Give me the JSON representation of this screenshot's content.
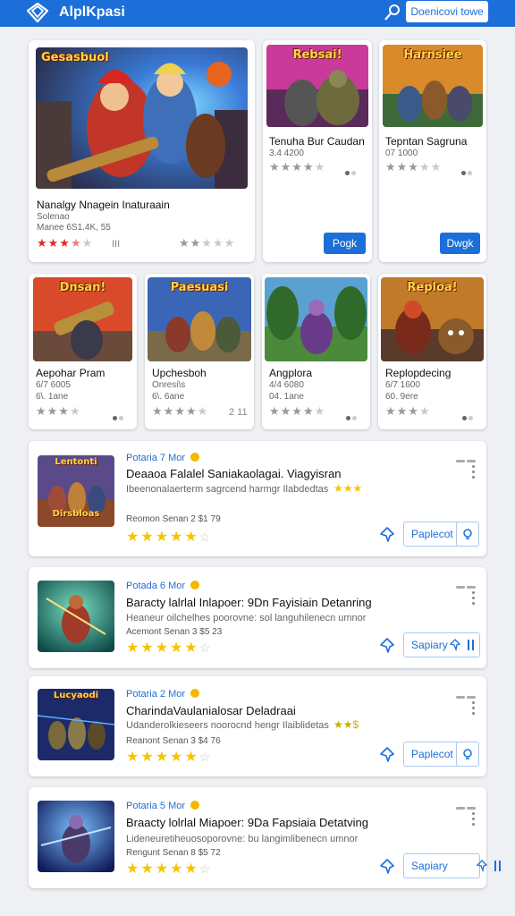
{
  "header": {
    "app_name": "AlplKpasi",
    "action_label": "Doenicovi towe",
    "colors": {
      "bar": "#1c6fd8"
    },
    "icons": [
      "app-logo-icon",
      "search-icon"
    ]
  },
  "featured": {
    "hero": {
      "banner": "Gesasbuol",
      "title": "Nanalgy Nnagein Inaturaain",
      "subtitle": "Solenao",
      "meta": "Manee 6S1.4K, 55",
      "rating": 3.5,
      "side_value": "III",
      "side_rating": 2
    },
    "cards": [
      {
        "banner": "Rebsai!",
        "title": "Tenuha Bur Caudan",
        "meta": "3.4 4200",
        "rating": 4,
        "button": "Pogk"
      },
      {
        "banner": "Harnsiee",
        "title": "Tepntan Sagruna",
        "meta": "07 1000",
        "rating": 3,
        "button": "Dwgk"
      }
    ]
  },
  "grid": [
    {
      "banner": "Dnsan!",
      "title": "Aepohar Pram",
      "line1": "6/7 6005",
      "line2": "6\\. 1ane",
      "rating": 3,
      "extra": ""
    },
    {
      "banner": "Paesuasi",
      "title": "Upchesboh",
      "line1": "Onresi\\s",
      "line2": "6\\. 6ane",
      "rating": 4,
      "extra": "2 11"
    },
    {
      "banner": "",
      "title": "Angplora",
      "line1": "4/4 6080",
      "line2": "04. 1ane",
      "rating": 4,
      "extra": ""
    },
    {
      "banner": "Reploa!",
      "title": "Replopdecing",
      "line1": "6/7 1600",
      "line2": "60. 9ere",
      "rating": 3,
      "extra": ""
    }
  ],
  "list": [
    {
      "banner": "Lentonti",
      "banner_bottom": "Dirsbloas",
      "meta": "Potaria 7 Mor",
      "title": "Deaaoa Falalel Saniakaolagai. Viagyisran",
      "desc": "Ibeenonalaerterm sagrcend harmgr Ilabdedtas",
      "price": "Reomon Senan 2 $1 79",
      "rating": 5,
      "mini_rating": "★★★",
      "action": "Paplecot",
      "right_icon": "pin-search-icon"
    },
    {
      "banner": "",
      "banner_bottom": "",
      "meta": "Potada 6 Mor",
      "title": "Baracty lalrlal Inlapoer: 9Dn Fayisiain Detanring",
      "desc": "Heaneur oilchelhes poorovne: sol languhilenecn umnor",
      "price": "Acemont Senan 3 $5 23",
      "rating": 5,
      "mini_rating": "",
      "action": "Sapiary",
      "right_icon": "equalizer-icon"
    },
    {
      "banner": "Lucyaodi",
      "banner_bottom": "",
      "meta": "Potaria 2 Mor",
      "title": "CharindaVaulanialosar Deladraai",
      "desc": "Udanderolkieseers noorocnd hengr Ilaiblidetas",
      "price": "Reanont Senan 3 $4 76",
      "rating": 5,
      "mini_rating": "★★$",
      "action": "Paplecot",
      "right_icon": "pin-search-icon"
    },
    {
      "banner": "",
      "banner_bottom": "",
      "meta": "Potaria 5 Mor",
      "title": "Braacty lolrlal Miapoer: 9Da Fapsiaia Detatving",
      "desc": "Lideneuretiheuosoporovne: bu langimlibenecn umnor",
      "price": "Rengunt Senan 8 $5 72",
      "rating": 5,
      "mini_rating": "",
      "action": "Sapiary",
      "right_icon": "equalizer-icon"
    }
  ]
}
